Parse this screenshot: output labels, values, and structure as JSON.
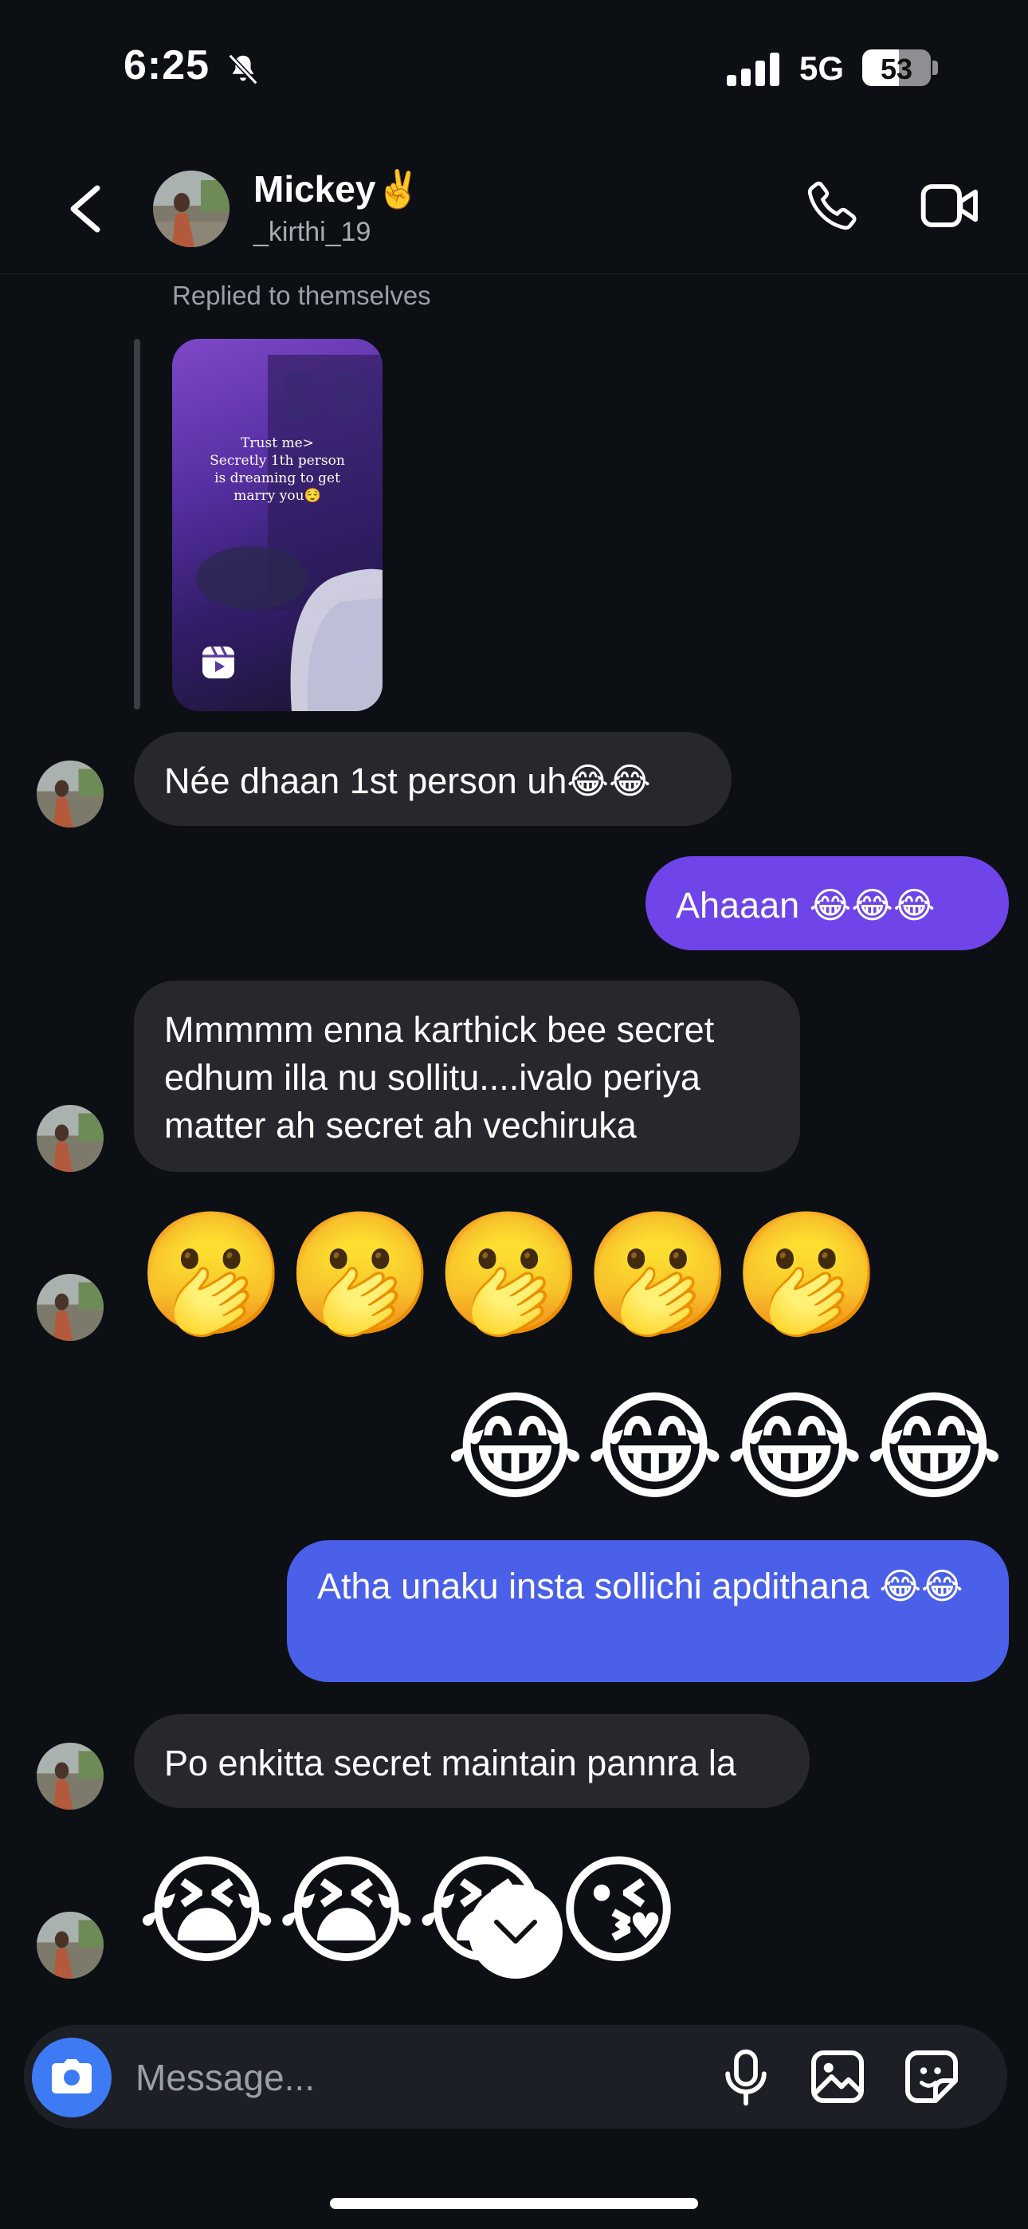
{
  "status_bar": {
    "time": "6:25",
    "network": "5G",
    "battery": "53",
    "battery_level": 0.53
  },
  "header": {
    "name": "Mickey✌️",
    "username": "_kirthi_19"
  },
  "reply_context": {
    "label": "Replied to themselves",
    "reel_text": "Trust me>\nSecretly 1th person\nis dreaming to get\nmarry you😌"
  },
  "messages": [
    {
      "side": "in",
      "text": "Née dhaan 1st person uh😂😂"
    },
    {
      "side": "out",
      "text": "Ahaaan 😂😂😂"
    },
    {
      "side": "in",
      "text": "Mmmmm enna karthick bee secret edhum illa nu sollitu....ivalo periya matter ah secret ah vechiruka"
    },
    {
      "side": "in",
      "emoji": "🫢🫢🫢🫢🫢"
    },
    {
      "side": "out",
      "emoji": "😂😂😂😂"
    },
    {
      "side": "out",
      "text": "Atha unaku insta sollichi apdithana 😂😂"
    },
    {
      "side": "in",
      "text": "Po enkitta secret maintain pannra la"
    },
    {
      "side": "in",
      "emoji": "😭😭😭😘"
    }
  ],
  "composer": {
    "placeholder": "Message..."
  },
  "icons": {
    "back": "chevron-left-icon",
    "call": "phone-icon",
    "video": "video-camera-icon",
    "camera": "camera-icon",
    "mic": "microphone-icon",
    "gallery": "image-icon",
    "sticker": "sticker-icon",
    "scroll": "chevron-down-icon",
    "reel": "reels-icon"
  },
  "colors": {
    "background": "#0c0f14",
    "incoming_bubble": "#26282e",
    "outgoing_purple": "#6f44e8",
    "outgoing_blue": "#4a60e8",
    "camera_button": "#3d7bf5"
  }
}
